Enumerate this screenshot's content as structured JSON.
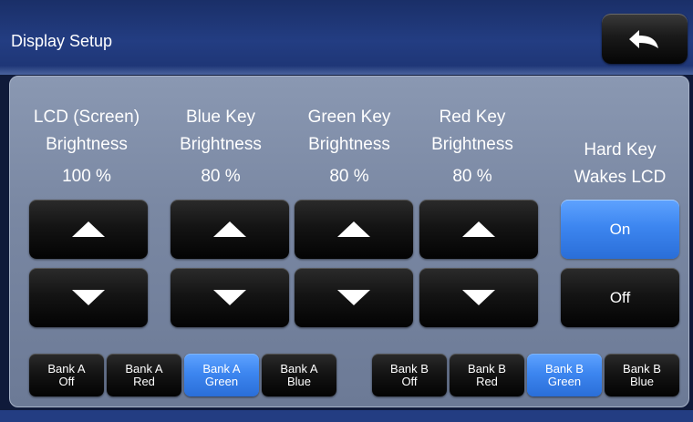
{
  "header": {
    "title": "Display Setup",
    "back_icon": "back-arrow-icon"
  },
  "controls": [
    {
      "line1": "LCD (Screen)",
      "line2": "Brightness",
      "value": "100 %"
    },
    {
      "line1": "Blue Key",
      "line2": "Brightness",
      "value": "80 %"
    },
    {
      "line1": "Green Key",
      "line2": "Brightness",
      "value": "80 %"
    },
    {
      "line1": "Red Key",
      "line2": "Brightness",
      "value": "80 %"
    }
  ],
  "hard_key": {
    "line1": "Hard Key",
    "line2": "Wakes LCD",
    "on_label": "On",
    "off_label": "Off",
    "selected": "On"
  },
  "banks": [
    {
      "l1": "Bank A",
      "l2": "Off"
    },
    {
      "l1": "Bank A",
      "l2": "Red"
    },
    {
      "l1": "Bank A",
      "l2": "Green"
    },
    {
      "l1": "Bank A",
      "l2": "Blue"
    },
    {
      "l1": "Bank B",
      "l2": "Off"
    },
    {
      "l1": "Bank B",
      "l2": "Red"
    },
    {
      "l1": "Bank B",
      "l2": "Green"
    },
    {
      "l1": "Bank B",
      "l2": "Blue"
    }
  ],
  "selected_banks": [
    "Bank A Green",
    "Bank B Green"
  ],
  "colors": {
    "accent": "#3d86f0",
    "header": "#233d82",
    "panel": "#7a88a3"
  }
}
